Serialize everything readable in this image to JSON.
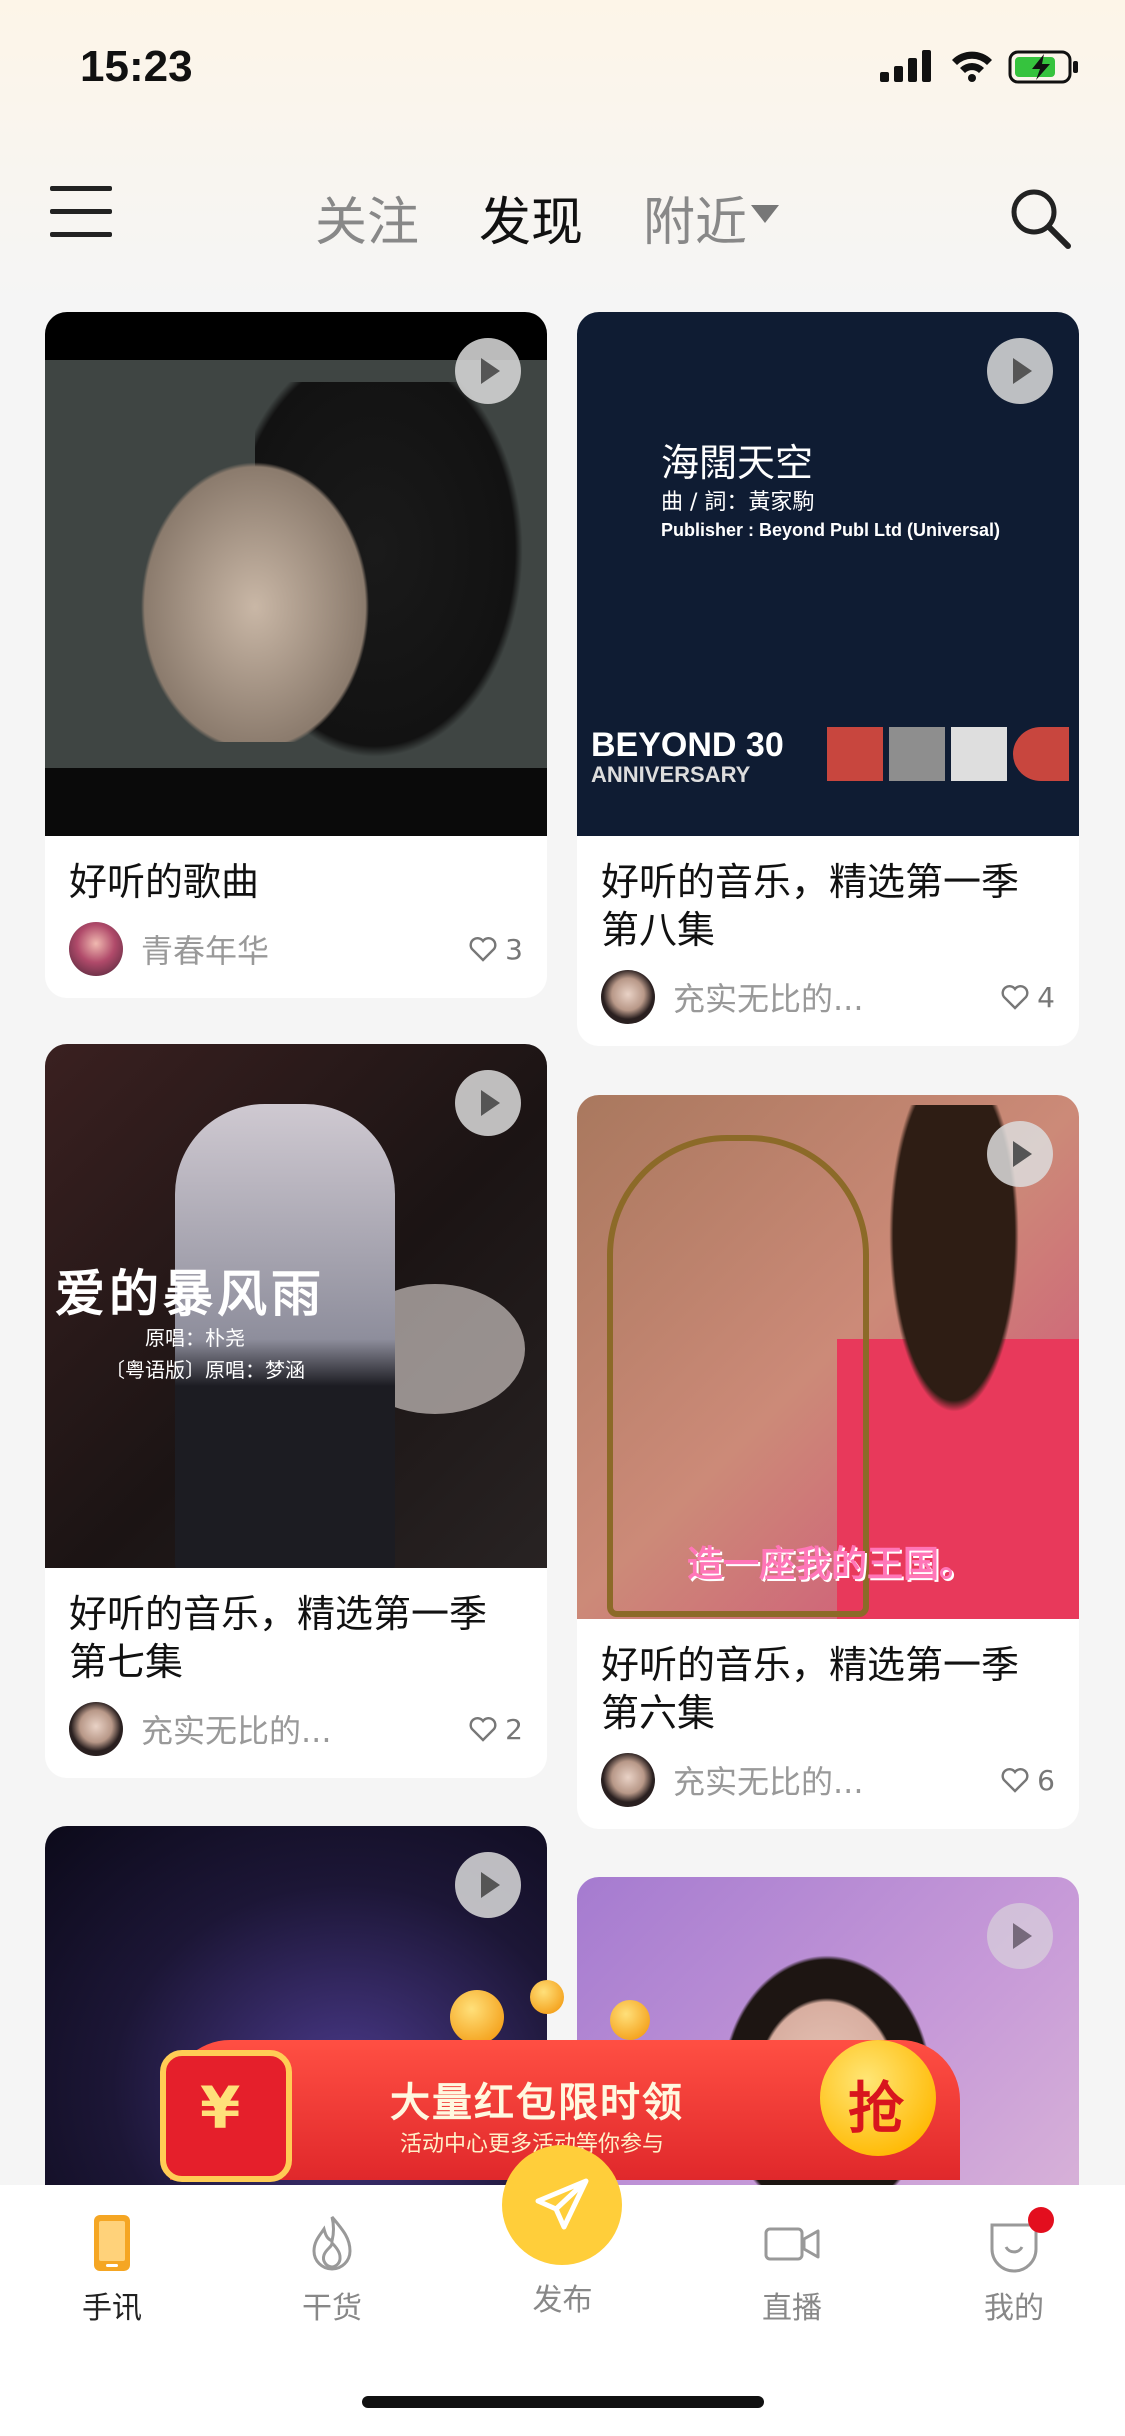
{
  "status_bar": {
    "time": "15:23"
  },
  "header": {
    "tabs": [
      {
        "label": "关注",
        "active": false
      },
      {
        "label": "发现",
        "active": true
      },
      {
        "label": "附近",
        "active": false,
        "has_dropdown": true
      }
    ],
    "icons": [
      "menu-icon",
      "search-icon"
    ]
  },
  "feed": [
    {
      "title": "好听的歌曲",
      "author": "青春年华",
      "likes": "3"
    },
    {
      "title": "好听的音乐，精选第一季第八集",
      "author": "充实无比的...",
      "likes": "4",
      "thumb_text": {
        "title": "海闊天空",
        "credit": "曲 / 詞：黃家駒",
        "publisher": "Publisher : Beyond Publ Ltd (Universal)",
        "brand": "BEYOND 30",
        "brand_sub": "ANNIVERSARY"
      }
    },
    {
      "title": "好听的音乐，精选第一季第七集",
      "author": "充实无比的...",
      "likes": "2",
      "thumb_text": {
        "title": "爱的暴风雨",
        "sub1": "原唱：朴尧",
        "sub2": "〔粤语版〕原唱：梦涵"
      }
    },
    {
      "title": "好听的音乐，精选第一季第六集",
      "author": "充实无比的...",
      "likes": "6",
      "thumb_text": {
        "caption": "造一座我的王国。"
      }
    },
    {
      "title": "",
      "author": "",
      "likes": ""
    },
    {
      "title": "",
      "author": "",
      "likes": ""
    }
  ],
  "promo": {
    "title": "大量红包限时领",
    "subtitle": "活动中心更多活动等你参与",
    "grab": "抢",
    "yen": "¥"
  },
  "bottom_nav": [
    {
      "label": "手讯",
      "icon": "phone-icon",
      "active": true
    },
    {
      "label": "干货",
      "icon": "fire-icon",
      "active": false
    },
    {
      "label": "发布",
      "icon": "send-icon",
      "active": false
    },
    {
      "label": "直播",
      "icon": "video-camera-icon",
      "active": false
    },
    {
      "label": "我的",
      "icon": "profile-icon",
      "active": false,
      "badge": true
    }
  ],
  "colors": {
    "accent": "#ffce3a",
    "badge": "#e30e1e",
    "promo_red": "#e0282b"
  }
}
